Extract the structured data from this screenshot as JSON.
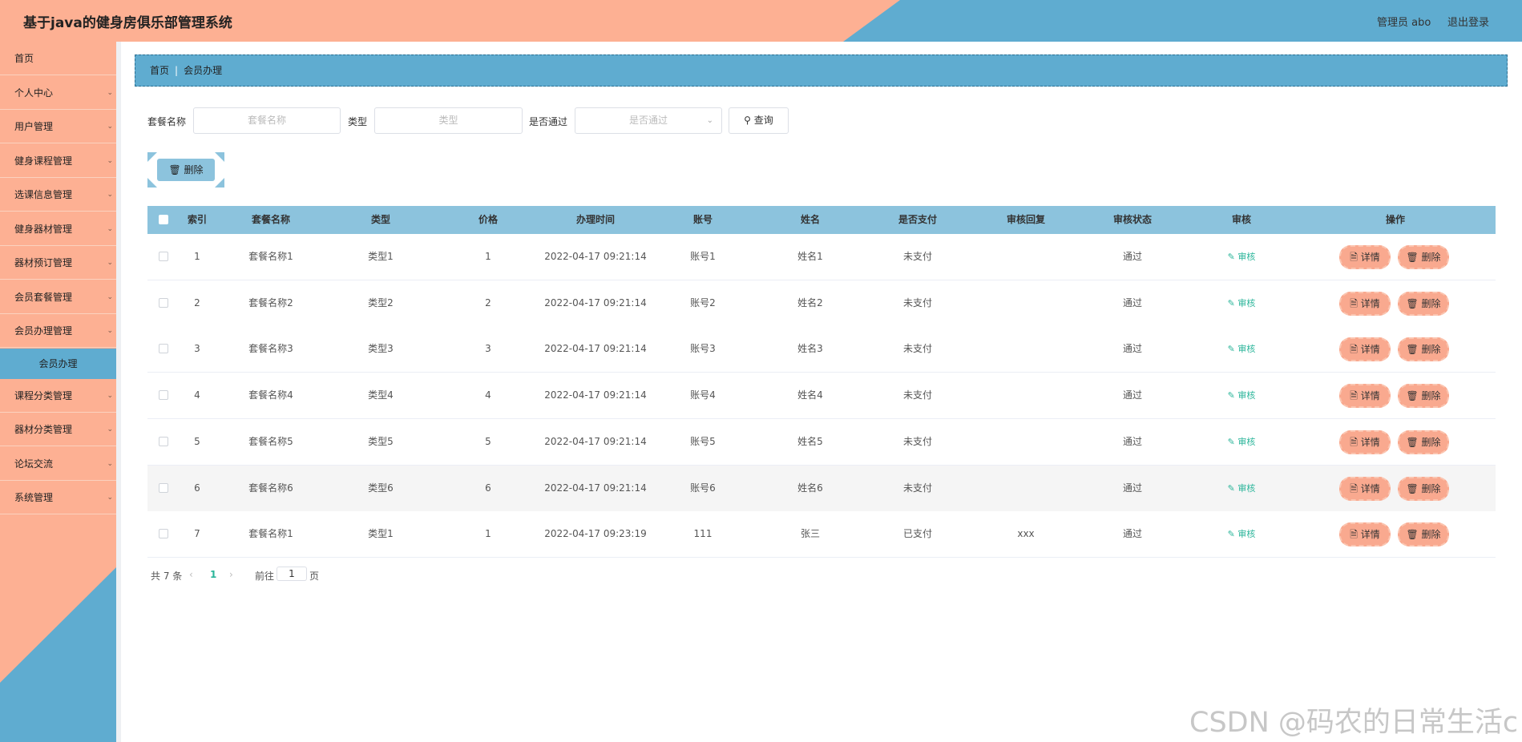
{
  "header": {
    "title": "基于java的健身房俱乐部管理系统",
    "user_label": "管理员 abo",
    "logout_label": "退出登录"
  },
  "sidebar": {
    "items": [
      {
        "label": "首页",
        "chevron": false
      },
      {
        "label": "个人中心",
        "chevron": true
      },
      {
        "label": "用户管理",
        "chevron": true
      },
      {
        "label": "健身课程管理",
        "chevron": true
      },
      {
        "label": "选课信息管理",
        "chevron": true
      },
      {
        "label": "健身器材管理",
        "chevron": true
      },
      {
        "label": "器材预订管理",
        "chevron": true
      },
      {
        "label": "会员套餐管理",
        "chevron": true
      },
      {
        "label": "会员办理管理",
        "chevron": true
      },
      {
        "label": "课程分类管理",
        "chevron": true
      },
      {
        "label": "器材分类管理",
        "chevron": true
      },
      {
        "label": "论坛交流",
        "chevron": true
      },
      {
        "label": "系统管理",
        "chevron": true
      }
    ],
    "active_sub": "会员办理"
  },
  "breadcrumb": {
    "home": "首页",
    "sep": "|",
    "current": "会员办理"
  },
  "search": {
    "name_label": "套餐名称",
    "name_placeholder": "套餐名称",
    "type_label": "类型",
    "type_placeholder": "类型",
    "pass_label": "是否通过",
    "pass_placeholder": "是否通过",
    "query_label": "查询"
  },
  "delete_label": "删除",
  "table": {
    "columns": [
      "索引",
      "套餐名称",
      "类型",
      "价格",
      "办理时间",
      "账号",
      "姓名",
      "是否支付",
      "审核回复",
      "审核状态",
      "审核",
      "操作"
    ],
    "rows": [
      {
        "index": "1",
        "name": "套餐名称1",
        "type": "类型1",
        "price": "1",
        "time": "2022-04-17 09:21:14",
        "account": "账号1",
        "person": "姓名1",
        "paid": "未支付",
        "reply": "",
        "status": "通过"
      },
      {
        "index": "2",
        "name": "套餐名称2",
        "type": "类型2",
        "price": "2",
        "time": "2022-04-17 09:21:14",
        "account": "账号2",
        "person": "姓名2",
        "paid": "未支付",
        "reply": "",
        "status": "通过"
      },
      {
        "index": "3",
        "name": "套餐名称3",
        "type": "类型3",
        "price": "3",
        "time": "2022-04-17 09:21:14",
        "account": "账号3",
        "person": "姓名3",
        "paid": "未支付",
        "reply": "",
        "status": "通过"
      },
      {
        "index": "4",
        "name": "套餐名称4",
        "type": "类型4",
        "price": "4",
        "time": "2022-04-17 09:21:14",
        "account": "账号4",
        "person": "姓名4",
        "paid": "未支付",
        "reply": "",
        "status": "通过"
      },
      {
        "index": "5",
        "name": "套餐名称5",
        "type": "类型5",
        "price": "5",
        "time": "2022-04-17 09:21:14",
        "account": "账号5",
        "person": "姓名5",
        "paid": "未支付",
        "reply": "",
        "status": "通过"
      },
      {
        "index": "6",
        "name": "套餐名称6",
        "type": "类型6",
        "price": "6",
        "time": "2022-04-17 09:21:14",
        "account": "账号6",
        "person": "姓名6",
        "paid": "未支付",
        "reply": "",
        "status": "通过"
      },
      {
        "index": "7",
        "name": "套餐名称1",
        "type": "类型1",
        "price": "1",
        "time": "2022-04-17 09:23:19",
        "account": "111",
        "person": "张三",
        "paid": "已支付",
        "reply": "xxx",
        "status": "通过"
      }
    ],
    "audit_label": "审核",
    "detail_label": "详情",
    "row_delete_label": "删除",
    "highlighted_row": 6
  },
  "pagination": {
    "total": "共 7 条",
    "current_page": "1",
    "goto_label": "前往",
    "goto_value": "1",
    "page_suffix": "页"
  },
  "watermark": "CSDN @码农的日常生活c",
  "colors": {
    "salmon": "#fdb093",
    "blue": "#5facd0",
    "light_blue": "#8cc3dd",
    "audit_green": "#2bb59a"
  }
}
